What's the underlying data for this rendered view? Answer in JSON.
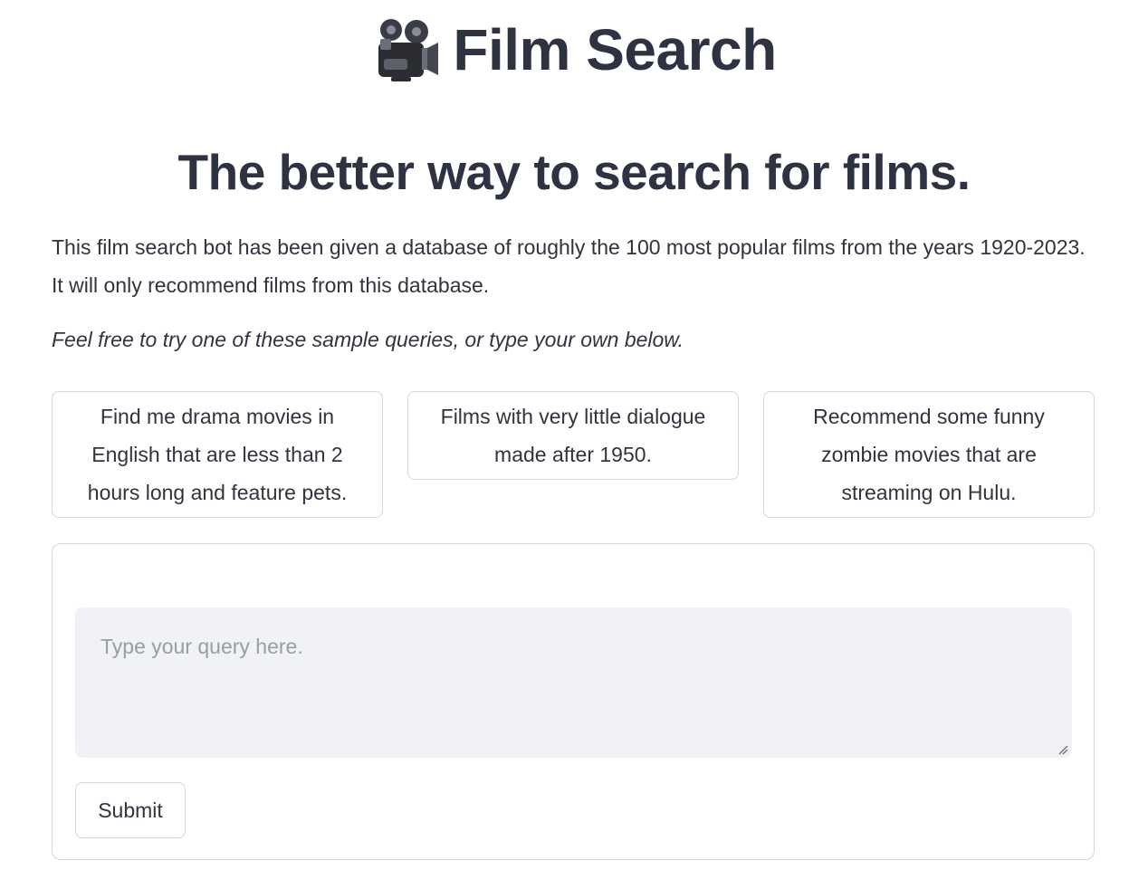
{
  "header": {
    "title": "Film Search",
    "title_icon": "movie-camera-icon"
  },
  "tagline": "The better way to search for films.",
  "description": "This film search bot has been given a database of roughly the 100 most popular films from the years 1920-2023. It will only recommend films from this database.",
  "hint": "Feel free to try one of these sample queries, or type your own below.",
  "samples": [
    {
      "label": "Find me drama movies in English that are less than 2 hours long and feature pets."
    },
    {
      "label": "Films with very little dialogue made after 1950."
    },
    {
      "label": "Recommend some funny zombie movies that are streaming on Hulu."
    }
  ],
  "form": {
    "query_placeholder": "Type your query here.",
    "query_value": "",
    "submit_label": "Submit"
  },
  "colors": {
    "text": "#31333f",
    "border": "#d6d6dc",
    "input_bg": "#f0f2f6",
    "placeholder": "#9a9ca6"
  }
}
